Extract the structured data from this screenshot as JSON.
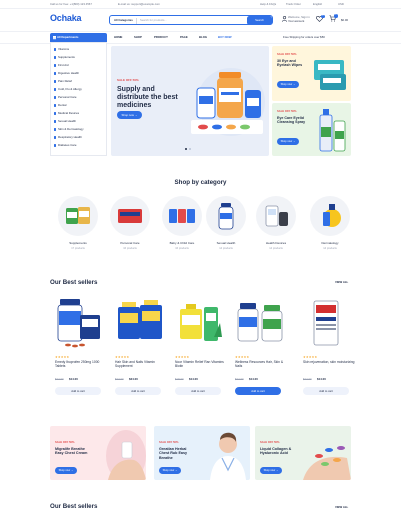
{
  "topbar": {
    "phone": "Call us for free: +1(800) 123 4567",
    "email": "E-mail us: support@example.com",
    "links": [
      "Help & FAQs",
      "Track Order",
      "English",
      "USD"
    ]
  },
  "header": {
    "logo": "Ochaka",
    "search_category": "All Categories",
    "search_placeholder": "Search for products...",
    "search_button": "Search",
    "account_line1": "Welcome, Sign in",
    "account_line2": "Your account",
    "wishlist_count": "0",
    "cart_count": "0",
    "cart_total": "$0.00"
  },
  "nav": {
    "departments": "All Departments",
    "items": [
      "HOME",
      "SHOP",
      "PRODUCT",
      "PAGE",
      "BLOG",
      "BUY NOW"
    ],
    "free_shipping": "Free Shipping for orders over $50"
  },
  "departments": [
    "Vitamins",
    "Supplements",
    "First Aid",
    "Digestive Health",
    "Pain Relief",
    "Cold, Flu & Allergy",
    "Personal Care",
    "Dental",
    "Medical Devices",
    "Sexual Health",
    "Skin & Dermatology",
    "Respiratory Health",
    "Diabetes Care"
  ],
  "hero": {
    "tag": "SALE OFF 50%",
    "title": "Supply and distribute the best medicines",
    "button": "Shop now"
  },
  "promos": [
    {
      "tag": "SALE OFF 50%",
      "title": "30 Eye and Eyelash Wipes",
      "button": "Shop now"
    },
    {
      "tag": "SALE OFF 50%",
      "title": "Eye Care Eyelid Cleansing Spray",
      "button": "Shop now"
    }
  ],
  "categories_title": "Shop by category",
  "categories": [
    {
      "name": "Supplements",
      "count": "17 products"
    },
    {
      "name": "Personal Care",
      "count": "16 products"
    },
    {
      "name": "Baby & Child Care",
      "count": "16 products"
    },
    {
      "name": "Sexual Health",
      "count": "14 products"
    },
    {
      "name": "Health Devices",
      "count": "14 products"
    },
    {
      "name": "Dermatology",
      "count": "14 products"
    }
  ],
  "bestsellers_title": "Our Best sellers",
  "view_all": "VIEW ALL",
  "products": [
    {
      "stars": "★★★★★",
      "name": "Emedy Ibuprofen 250mg 1000 Tablets",
      "old": "$24.00",
      "price": "$14.00",
      "button": "Add to cart"
    },
    {
      "stars": "★★★★★",
      "name": "Hair Skin and Nails Vitamin Supplement",
      "old": "$27.00",
      "price": "$24.00",
      "button": "Add to cart"
    },
    {
      "stars": "★★★★★",
      "name": "Noor Vitamin Relief Ran Vitamins Biotin",
      "old": "$18.00",
      "price": "$14.00",
      "button": "Add to cart"
    },
    {
      "stars": "★★★★★",
      "name": "Wellness Resources Hair, Skin & Nails",
      "old": "$24.00",
      "price": "$14.00",
      "button": "Add to cart"
    },
    {
      "stars": "★★★★★",
      "name": "Skin rejuvenation, skin moisturizing",
      "old": "$24.00",
      "price": "$14.00",
      "button": "Add to cart"
    }
  ],
  "banners": [
    {
      "tag": "SALE OFF 50%",
      "title": "Migralife Breathe Easy Chest Cream",
      "button": "Shop now"
    },
    {
      "tag": "SALE OFF 50%",
      "title": "Greatlan Herbal Chest Rub Easy Breathe",
      "button": "Shop now"
    },
    {
      "tag": "SALE OFF 50%",
      "title": "Liquid Collagen & Hyaluronic Acid",
      "button": "Shop now"
    }
  ],
  "bestsellers_title_2": "Our Best sellers",
  "view_all_2": "VIEW ALL",
  "colors": {
    "primary": "#2f6fe6",
    "sale": "#e24b4b",
    "text": "#1f2a44",
    "star": "#f5a623"
  }
}
